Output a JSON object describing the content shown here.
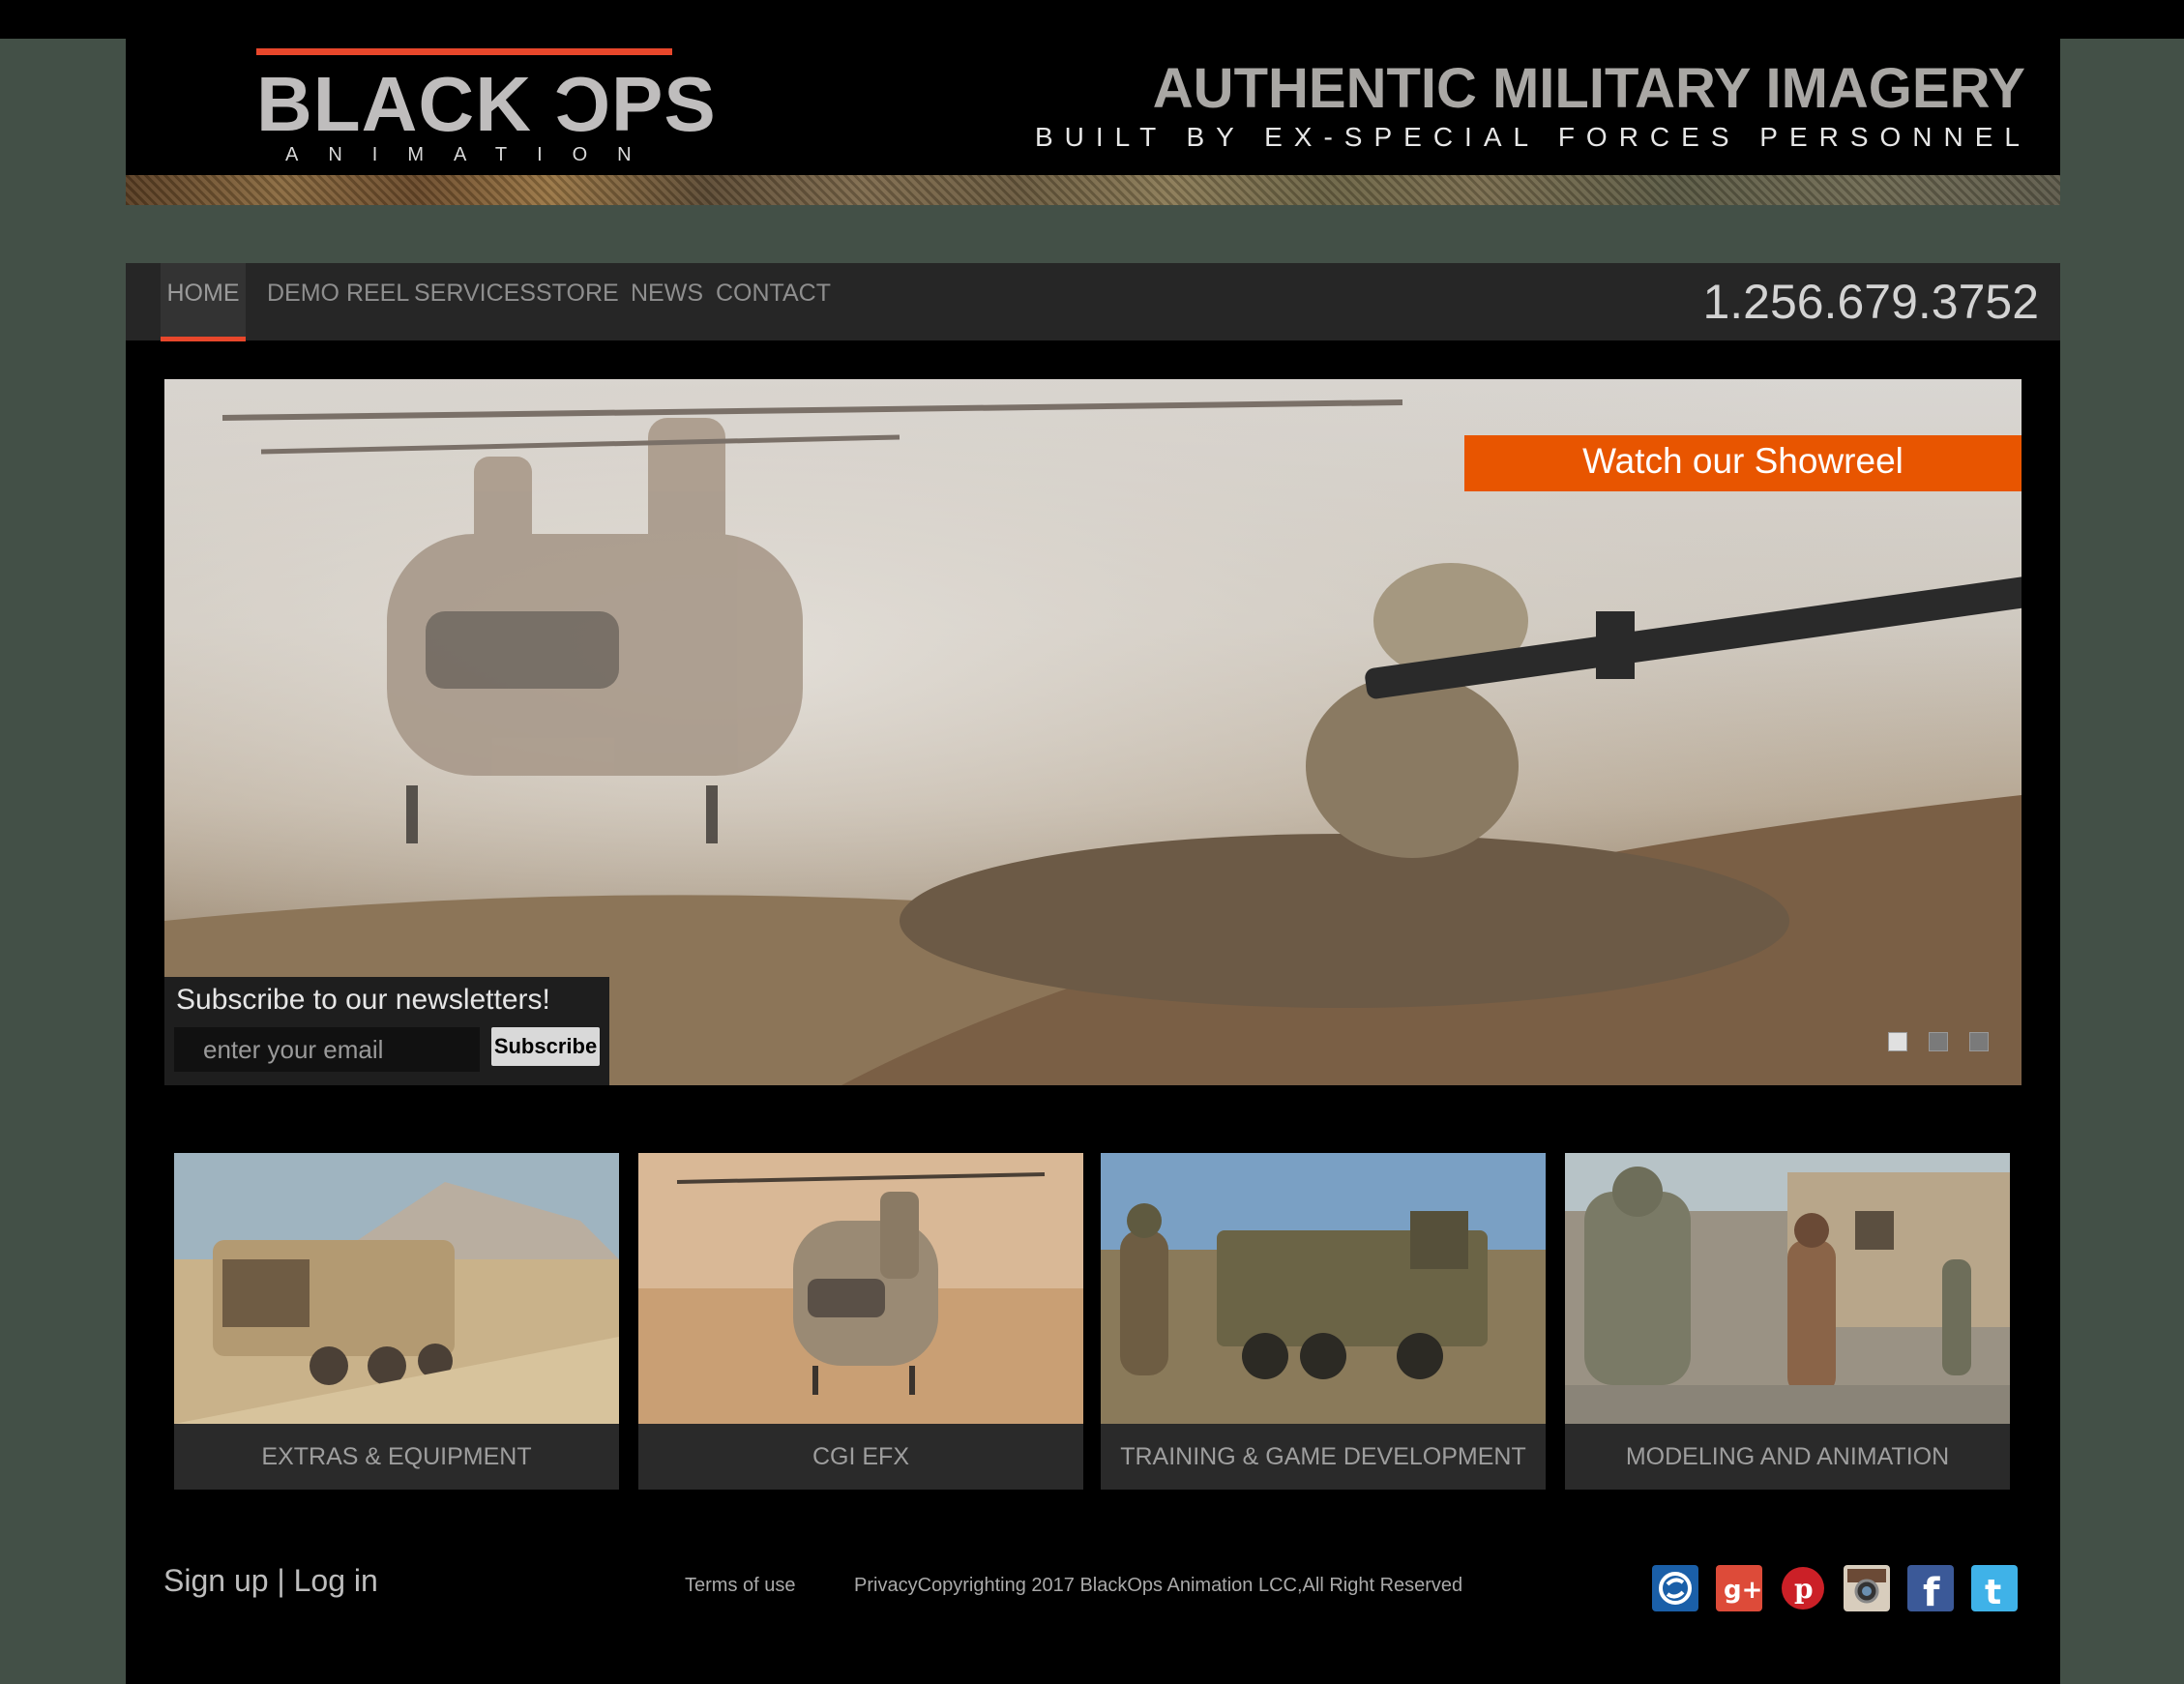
{
  "brand": {
    "logo_word": "BLACK ƆPS",
    "logo_sub": "ANIMATION",
    "tagline": "AUTHENTIC MILITARY IMAGERY",
    "subtagline": "BUILT BY EX-SPECIAL FORCES PERSONNEL",
    "accent_color": "#e8472b"
  },
  "nav": {
    "items": [
      {
        "label": "HOME",
        "active": true
      },
      {
        "label": "DEMO REEL",
        "active": false
      },
      {
        "label": "SERVICES",
        "active": false
      },
      {
        "label": "STORE",
        "active": false
      },
      {
        "label": "NEWS",
        "active": false
      },
      {
        "label": "CONTACT",
        "active": false
      }
    ],
    "phone": "1.256.679.3752"
  },
  "hero": {
    "cta_label": "Watch our Showreel",
    "cta_color": "#e85500",
    "slides_total": 3,
    "active_slide": 1
  },
  "newsletter": {
    "title": "Subscribe to our newsletters!",
    "email_placeholder": "enter your email",
    "button_label": "Subscribe"
  },
  "services": [
    {
      "label": "EXTRAS & EQUIPMENT",
      "image": "armored-vehicle-desert"
    },
    {
      "label": "CGI EFX",
      "image": "chinook-helicopter"
    },
    {
      "label": "TRAINING & GAME DEVELOPMENT",
      "image": "soldiers-truck"
    },
    {
      "label": "MODELING AND ANIMATION",
      "image": "soldiers-village"
    }
  ],
  "footer": {
    "signup": "Sign up",
    "separator": "|",
    "login": "Log in",
    "terms": "Terms of use",
    "copyright": "PrivacyCopyrighting 2017 BlackOps Animation LCC,All Right Reserved",
    "social_icons": [
      "skype-icon",
      "google-plus-icon",
      "pinterest-icon",
      "instagram-icon",
      "facebook-icon",
      "twitter-icon"
    ]
  }
}
